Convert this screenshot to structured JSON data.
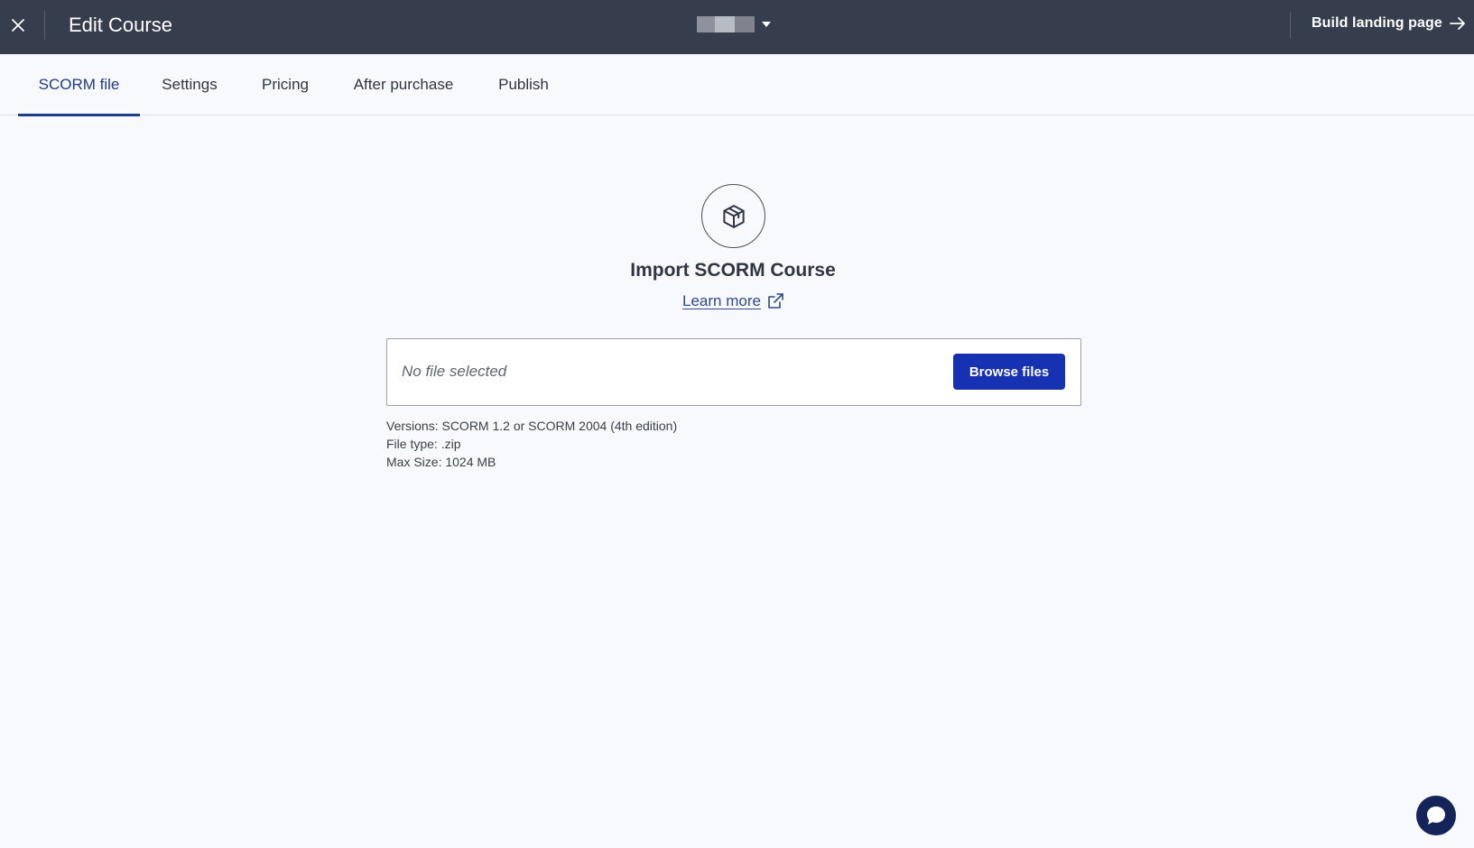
{
  "header": {
    "title": "Edit Course",
    "build_link": "Build landing page",
    "icons": {
      "close": "close-icon",
      "switcher_caret": "caret-down-icon",
      "build_arrow": "arrow-right-icon"
    }
  },
  "tabs": [
    {
      "label": "SCORM file",
      "active": true
    },
    {
      "label": "Settings",
      "active": false
    },
    {
      "label": "Pricing",
      "active": false
    },
    {
      "label": "After purchase",
      "active": false
    },
    {
      "label": "Publish",
      "active": false
    }
  ],
  "main": {
    "icon": "package-icon",
    "heading": "Import SCORM Course",
    "learn_more": "Learn more",
    "learn_more_icon": "external-link-icon",
    "file_input": {
      "value": "No file selected",
      "button": "Browse files"
    },
    "help": [
      "Versions: SCORM 1.2 or SCORM 2004 (4th edition)",
      "File type: .zip",
      "Max Size: 1024 MB"
    ]
  },
  "chat": {
    "icon": "chat-bubble-icon"
  },
  "colors": {
    "topbar": "#363d4c",
    "accent": "#1e3a8a",
    "primary_button": "#1631b2",
    "background": "#f7f9fc",
    "chat_button": "#14235a"
  }
}
